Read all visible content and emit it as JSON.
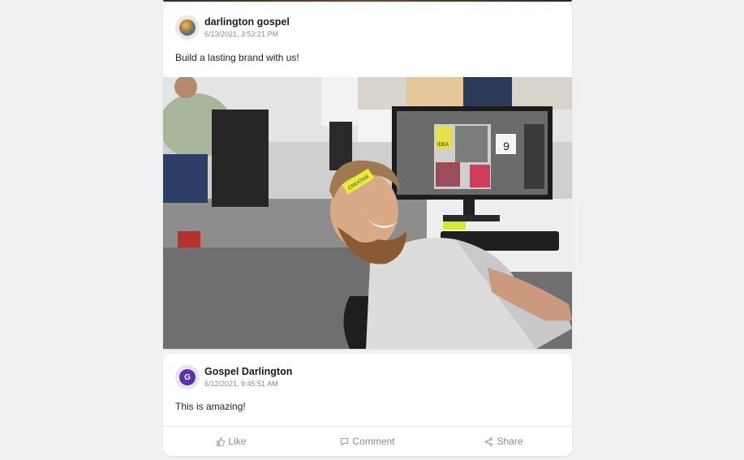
{
  "post": {
    "author": "darlington gospel",
    "timestamp": "6/13/2021, 3:53:21 PM",
    "text": "Build a lasting brand with us!"
  },
  "comment": {
    "author": "Gospel Darlington",
    "avatar_letter": "G",
    "timestamp": "6/12/2021, 9:45:51 AM",
    "text": "This is amazing!"
  },
  "actions": {
    "like_label": "Like",
    "comment_label": "Comment",
    "share_label": "Share"
  },
  "photo": {
    "sticky_note_text": "CREATIVE",
    "screen_text": "IDEA",
    "screen_number": "9"
  },
  "colors": {
    "avatar_letter_bg": "#5b2fb0",
    "muted_text": "#8a8a8a",
    "page_background": "#f0f1f3"
  },
  "icons": {
    "like": "thumbs-up-icon",
    "comment": "comment-icon",
    "share": "share-icon"
  }
}
